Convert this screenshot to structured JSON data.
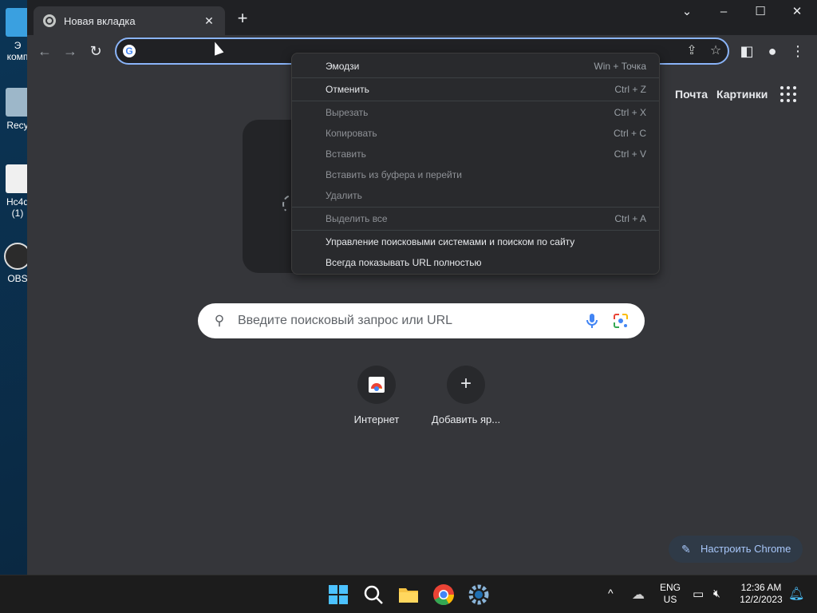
{
  "desktop": {
    "icons": [
      {
        "label": "Э\nкомп"
      },
      {
        "label": "Recy"
      },
      {
        "label": "Hc4d\n(1)"
      },
      {
        "label": "OBS"
      }
    ]
  },
  "browser": {
    "tab_title": "Новая вкладка",
    "omnibox_value": "",
    "header_links": [
      "Почта",
      "Картинки"
    ],
    "search_placeholder": "Введите поисковый запрос или URL",
    "shortcuts": [
      {
        "label": "Интернет",
        "icon": "site-favicon"
      },
      {
        "label": "Добавить яр...",
        "icon": "plus-icon"
      }
    ],
    "customize_label": "Настроить Chrome"
  },
  "context_menu": {
    "items": [
      {
        "label": "Эмодзи",
        "shortcut": "Win + Точка",
        "enabled": true
      },
      {
        "label": "Отменить",
        "shortcut": "Ctrl + Z",
        "enabled": true
      },
      {
        "label": "Вырезать",
        "shortcut": "Ctrl + X",
        "enabled": false
      },
      {
        "label": "Копировать",
        "shortcut": "Ctrl + C",
        "enabled": false
      },
      {
        "label": "Вставить",
        "shortcut": "Ctrl + V",
        "enabled": false
      },
      {
        "label": "Вставить из буфера и перейти",
        "shortcut": "",
        "enabled": false
      },
      {
        "label": "Удалить",
        "shortcut": "",
        "enabled": false
      },
      {
        "label": "Выделить все",
        "shortcut": "Ctrl + A",
        "enabled": false
      },
      {
        "label": "Управление поисковыми системами и поиском по сайту",
        "shortcut": "",
        "enabled": true
      },
      {
        "label": "Всегда показывать URL полностью",
        "shortcut": "",
        "enabled": true
      }
    ]
  },
  "taskbar": {
    "lang": "ENG",
    "region": "US",
    "time": "12:36 AM",
    "date": "12/2/2023"
  },
  "colors": {
    "accent": "#8ab4f8",
    "window_bg": "#35363a",
    "tabstrip_bg": "#202124",
    "menu_bg": "#292a2d"
  }
}
